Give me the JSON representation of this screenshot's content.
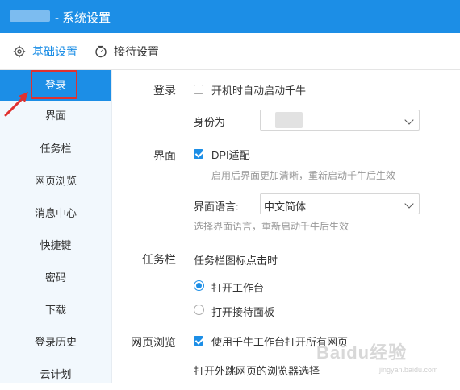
{
  "window": {
    "title": "- 系统设置"
  },
  "tabs": [
    {
      "label": "基础设置",
      "active": true,
      "icon": "gear-icon"
    },
    {
      "label": "接待设置",
      "active": false,
      "icon": "clock-icon"
    }
  ],
  "sidebar": {
    "items": [
      {
        "label": "登录",
        "active": true
      },
      {
        "label": "界面"
      },
      {
        "label": "任务栏"
      },
      {
        "label": "网页浏览"
      },
      {
        "label": "消息中心"
      },
      {
        "label": "快捷键"
      },
      {
        "label": "密码"
      },
      {
        "label": "下载"
      },
      {
        "label": "登录历史"
      },
      {
        "label": "云计划"
      }
    ]
  },
  "login": {
    "section": "登录",
    "autostart": {
      "label": "开机时自动启动千牛",
      "checked": false
    },
    "identity_label": "身份为",
    "identity_value": ""
  },
  "ui": {
    "section": "界面",
    "dpi": {
      "label": "DPI适配",
      "checked": true
    },
    "dpi_hint": "启用后界面更加清晰，重新启动千牛后生效",
    "language_label": "界面语言:",
    "language_value": "中文简体",
    "language_hint": "选择界面语言，重新启动千牛后生效"
  },
  "taskbar": {
    "section": "任务栏",
    "click_label": "任务栏图标点击时",
    "options": [
      {
        "label": "打开工作台",
        "selected": true
      },
      {
        "label": "打开接待面板",
        "selected": false
      }
    ]
  },
  "web": {
    "section": "网页浏览",
    "use_workbench": {
      "label": "使用千牛工作台打开所有网页",
      "checked": true
    },
    "external_label": "打开外跳网页的浏览器选择"
  },
  "watermark": {
    "text": "Baidu经验",
    "sub": "jingyan.baidu.com"
  },
  "colors": {
    "accent": "#1c8ee6",
    "annotation": "#e0312f"
  }
}
